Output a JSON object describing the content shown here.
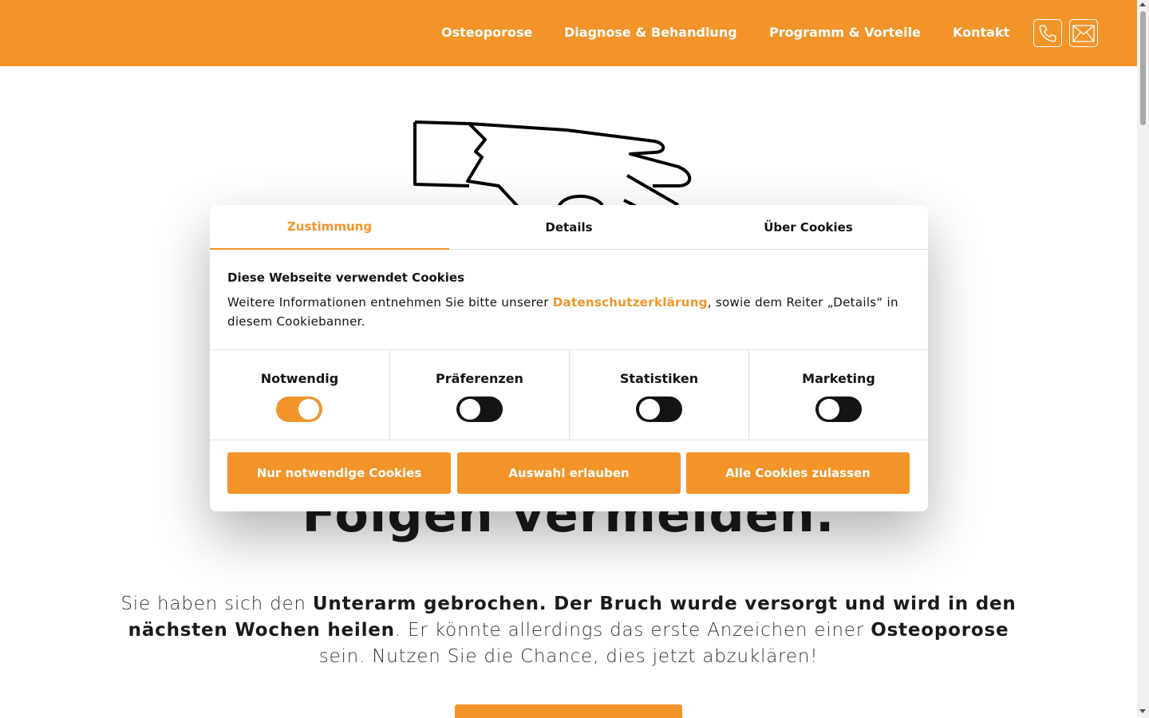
{
  "header": {
    "nav": [
      {
        "label": "Osteoporose"
      },
      {
        "label": "Diagnose & Behandlung"
      },
      {
        "label": "Programm & Vorteile"
      },
      {
        "label": "Kontakt"
      }
    ],
    "icons": [
      "phone-icon",
      "mail-icon"
    ]
  },
  "hero": {
    "heading": "Folgen vermeiden.",
    "text_parts": [
      "Sie haben sich den ",
      "Unterarm gebrochen. Der Bruch wurde versorgt und wird in den nächsten Wochen heilen",
      ". Er könnte allerdings das erste Anzeichen einer ",
      "Osteoporose",
      " sein. Nutzen Sie die Chance, dies jetzt abzuklären!"
    ]
  },
  "cookie": {
    "tabs": [
      {
        "label": "Zustimmung"
      },
      {
        "label": "Details"
      },
      {
        "label": "Über Cookies"
      }
    ],
    "title": "Diese Webseite verwendet Cookies",
    "desc_before": "Weitere Informationen entnehmen Sie bitte unserer ",
    "desc_link": "Datenschutzerklärung",
    "desc_after": ", sowie dem Reiter „Details“ in diesem Cookiebanner.",
    "toggles": [
      {
        "label": "Notwendig",
        "on": true
      },
      {
        "label": "Präferenzen",
        "on": false
      },
      {
        "label": "Statistiken",
        "on": false
      },
      {
        "label": "Marketing",
        "on": false
      }
    ],
    "buttons": [
      {
        "label": "Nur notwendige Cookies"
      },
      {
        "label": "Auswahl erlauben"
      },
      {
        "label": "Alle Cookies zulassen"
      }
    ]
  },
  "colors": {
    "accent": "#f2942a",
    "text": "#141414",
    "toggle_off": "#141414"
  }
}
